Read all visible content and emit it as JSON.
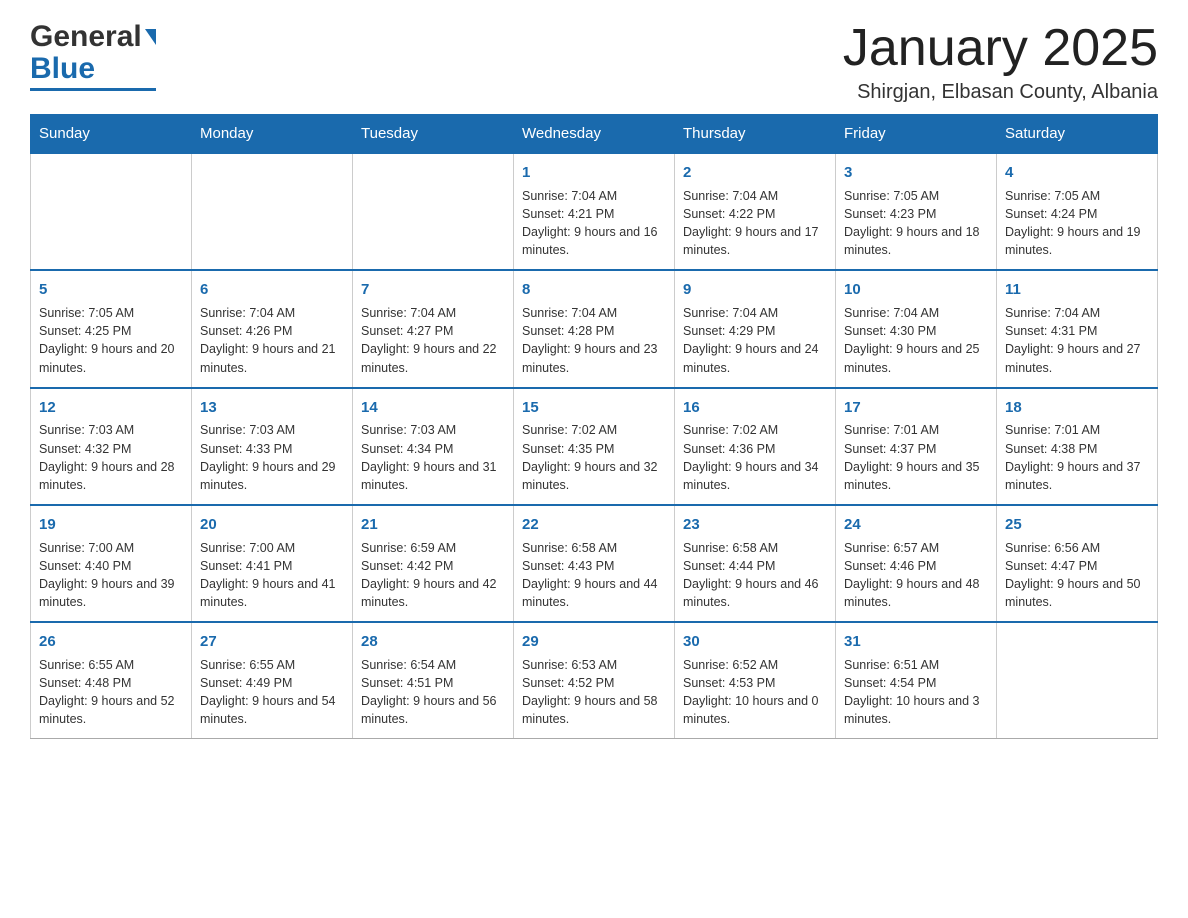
{
  "header": {
    "logo_general": "General",
    "logo_blue": "Blue",
    "month_title": "January 2025",
    "location": "Shirgjan, Elbasan County, Albania"
  },
  "days_of_week": [
    "Sunday",
    "Monday",
    "Tuesday",
    "Wednesday",
    "Thursday",
    "Friday",
    "Saturday"
  ],
  "weeks": [
    [
      {
        "day": "",
        "info": ""
      },
      {
        "day": "",
        "info": ""
      },
      {
        "day": "",
        "info": ""
      },
      {
        "day": "1",
        "info": "Sunrise: 7:04 AM\nSunset: 4:21 PM\nDaylight: 9 hours and 16 minutes."
      },
      {
        "day": "2",
        "info": "Sunrise: 7:04 AM\nSunset: 4:22 PM\nDaylight: 9 hours and 17 minutes."
      },
      {
        "day": "3",
        "info": "Sunrise: 7:05 AM\nSunset: 4:23 PM\nDaylight: 9 hours and 18 minutes."
      },
      {
        "day": "4",
        "info": "Sunrise: 7:05 AM\nSunset: 4:24 PM\nDaylight: 9 hours and 19 minutes."
      }
    ],
    [
      {
        "day": "5",
        "info": "Sunrise: 7:05 AM\nSunset: 4:25 PM\nDaylight: 9 hours and 20 minutes."
      },
      {
        "day": "6",
        "info": "Sunrise: 7:04 AM\nSunset: 4:26 PM\nDaylight: 9 hours and 21 minutes."
      },
      {
        "day": "7",
        "info": "Sunrise: 7:04 AM\nSunset: 4:27 PM\nDaylight: 9 hours and 22 minutes."
      },
      {
        "day": "8",
        "info": "Sunrise: 7:04 AM\nSunset: 4:28 PM\nDaylight: 9 hours and 23 minutes."
      },
      {
        "day": "9",
        "info": "Sunrise: 7:04 AM\nSunset: 4:29 PM\nDaylight: 9 hours and 24 minutes."
      },
      {
        "day": "10",
        "info": "Sunrise: 7:04 AM\nSunset: 4:30 PM\nDaylight: 9 hours and 25 minutes."
      },
      {
        "day": "11",
        "info": "Sunrise: 7:04 AM\nSunset: 4:31 PM\nDaylight: 9 hours and 27 minutes."
      }
    ],
    [
      {
        "day": "12",
        "info": "Sunrise: 7:03 AM\nSunset: 4:32 PM\nDaylight: 9 hours and 28 minutes."
      },
      {
        "day": "13",
        "info": "Sunrise: 7:03 AM\nSunset: 4:33 PM\nDaylight: 9 hours and 29 minutes."
      },
      {
        "day": "14",
        "info": "Sunrise: 7:03 AM\nSunset: 4:34 PM\nDaylight: 9 hours and 31 minutes."
      },
      {
        "day": "15",
        "info": "Sunrise: 7:02 AM\nSunset: 4:35 PM\nDaylight: 9 hours and 32 minutes."
      },
      {
        "day": "16",
        "info": "Sunrise: 7:02 AM\nSunset: 4:36 PM\nDaylight: 9 hours and 34 minutes."
      },
      {
        "day": "17",
        "info": "Sunrise: 7:01 AM\nSunset: 4:37 PM\nDaylight: 9 hours and 35 minutes."
      },
      {
        "day": "18",
        "info": "Sunrise: 7:01 AM\nSunset: 4:38 PM\nDaylight: 9 hours and 37 minutes."
      }
    ],
    [
      {
        "day": "19",
        "info": "Sunrise: 7:00 AM\nSunset: 4:40 PM\nDaylight: 9 hours and 39 minutes."
      },
      {
        "day": "20",
        "info": "Sunrise: 7:00 AM\nSunset: 4:41 PM\nDaylight: 9 hours and 41 minutes."
      },
      {
        "day": "21",
        "info": "Sunrise: 6:59 AM\nSunset: 4:42 PM\nDaylight: 9 hours and 42 minutes."
      },
      {
        "day": "22",
        "info": "Sunrise: 6:58 AM\nSunset: 4:43 PM\nDaylight: 9 hours and 44 minutes."
      },
      {
        "day": "23",
        "info": "Sunrise: 6:58 AM\nSunset: 4:44 PM\nDaylight: 9 hours and 46 minutes."
      },
      {
        "day": "24",
        "info": "Sunrise: 6:57 AM\nSunset: 4:46 PM\nDaylight: 9 hours and 48 minutes."
      },
      {
        "day": "25",
        "info": "Sunrise: 6:56 AM\nSunset: 4:47 PM\nDaylight: 9 hours and 50 minutes."
      }
    ],
    [
      {
        "day": "26",
        "info": "Sunrise: 6:55 AM\nSunset: 4:48 PM\nDaylight: 9 hours and 52 minutes."
      },
      {
        "day": "27",
        "info": "Sunrise: 6:55 AM\nSunset: 4:49 PM\nDaylight: 9 hours and 54 minutes."
      },
      {
        "day": "28",
        "info": "Sunrise: 6:54 AM\nSunset: 4:51 PM\nDaylight: 9 hours and 56 minutes."
      },
      {
        "day": "29",
        "info": "Sunrise: 6:53 AM\nSunset: 4:52 PM\nDaylight: 9 hours and 58 minutes."
      },
      {
        "day": "30",
        "info": "Sunrise: 6:52 AM\nSunset: 4:53 PM\nDaylight: 10 hours and 0 minutes."
      },
      {
        "day": "31",
        "info": "Sunrise: 6:51 AM\nSunset: 4:54 PM\nDaylight: 10 hours and 3 minutes."
      },
      {
        "day": "",
        "info": ""
      }
    ]
  ]
}
